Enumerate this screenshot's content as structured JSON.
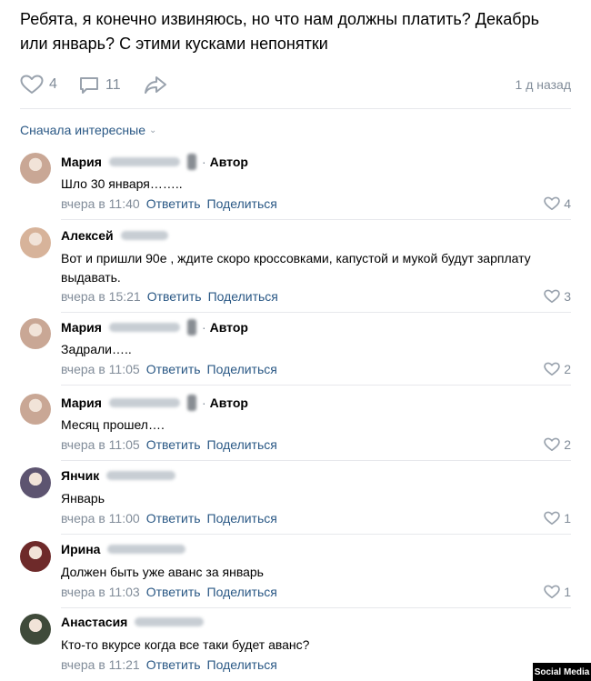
{
  "post": {
    "text": "Ребята, я конечно извиняюсь, но что нам должны платить? Декабрь или январь? С этими кусками непонятки",
    "likes": "4",
    "comments_count": "11",
    "time_ago": "1 д назад"
  },
  "sort_label": "Сначала интересные",
  "reply_label": "Ответить",
  "share_label": "Поделиться",
  "author_label": "Автор",
  "comments": [
    {
      "name": "Мария",
      "author": true,
      "text": "Шло 30 января……..",
      "time": "вчера в 11:40",
      "likes": "4",
      "avatar_color": "#c9a795"
    },
    {
      "name": "Алексей",
      "author": false,
      "text": "Вот и пришли 90е , ждите скоро кроссовками, капустой и мукой будут зарплату выдавать.",
      "time": "вчера в 15:21",
      "likes": "3",
      "avatar_color": "#d7b39a"
    },
    {
      "name": "Мария",
      "author": true,
      "text": "Задрали…..",
      "time": "вчера в 11:05",
      "likes": "2",
      "avatar_color": "#c9a795"
    },
    {
      "name": "Мария",
      "author": true,
      "text": "Месяц прошел….",
      "time": "вчера в 11:05",
      "likes": "2",
      "avatar_color": "#c9a795"
    },
    {
      "name": "Янчик",
      "author": false,
      "text": "Январь",
      "time": "вчера в 11:00",
      "likes": "1",
      "avatar_color": "#5d5470"
    },
    {
      "name": "Ирина",
      "author": false,
      "text": "Должен быть уже аванс за январь",
      "time": "вчера в 11:03",
      "likes": "1",
      "avatar_color": "#6e2a2a"
    },
    {
      "name": "Анастасия",
      "author": false,
      "text": "Кто-то вкурсе когда все таки будет аванс?",
      "time": "вчера в 11:21",
      "likes": "",
      "avatar_color": "#3f4a3a"
    }
  ],
  "watermark": "Social Media",
  "colors": {
    "link": "#2a5885",
    "meta": "#818c99",
    "divider": "#e7e8ec"
  }
}
